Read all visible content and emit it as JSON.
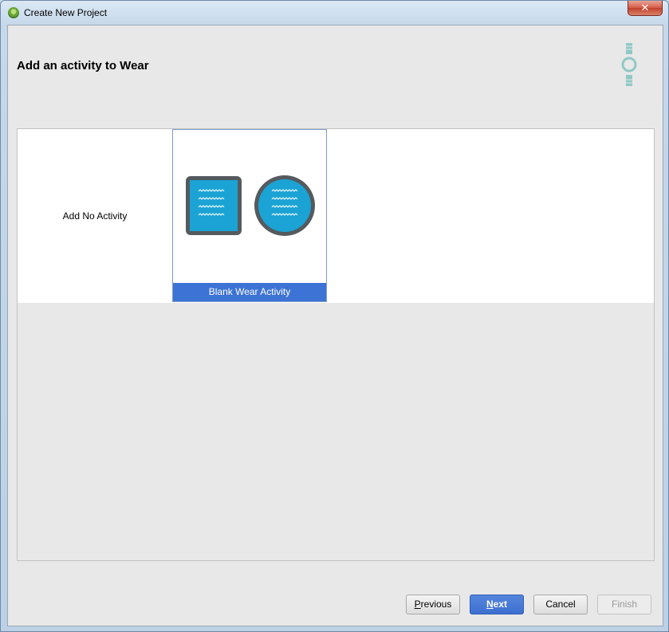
{
  "window": {
    "title": "Create New Project",
    "close_label": "✕"
  },
  "header": {
    "title": "Add an activity to Wear"
  },
  "gallery": {
    "items": [
      {
        "label": "Add No Activity",
        "selected": false
      },
      {
        "label": "Blank Wear Activity",
        "selected": true
      }
    ]
  },
  "footer": {
    "previous_mnemonic": "P",
    "previous_rest": "revious",
    "next_mnemonic": "N",
    "next_rest": "ext",
    "cancel_label": "Cancel",
    "finish_label": "Finish"
  },
  "colors": {
    "accent": "#3c73d4",
    "wear_blue": "#1aa3d4",
    "frame": "#555a5e",
    "logo": "#8fc9c6"
  },
  "icons": {
    "app": "android-studio-icon",
    "wear_logo": "android-wear-icon",
    "square_watch": "square-watch-icon",
    "round_watch": "round-watch-icon"
  }
}
